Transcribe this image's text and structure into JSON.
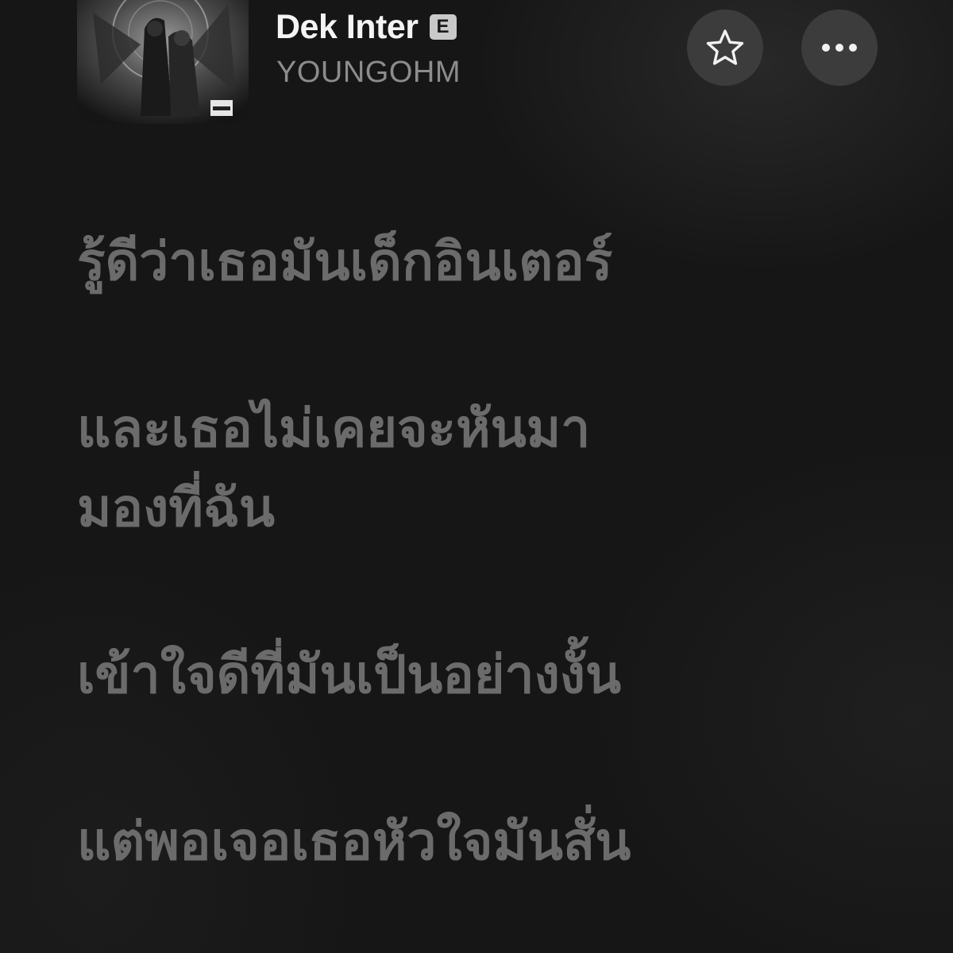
{
  "now_playing": {
    "title": "Dek Inter",
    "explicit_badge": "E",
    "artist": "YOUNGOHM",
    "artwork_icon": "album-artwork",
    "favorite_icon": "star-icon",
    "more_icon": "ellipsis-icon"
  },
  "colors": {
    "background": "#161616",
    "title": "#f4f4f4",
    "artist": "#8c8c8c",
    "lyrics_inactive": "#6b6b6b",
    "button_bg": "#3c3c3c"
  },
  "lyrics": [
    {
      "lines": [
        "รู้ดีว่าเธอมันเด็กอินเตอร์"
      ]
    },
    {
      "lines": [
        "และเธอไม่เคยจะหันมา",
        "มองที่ฉัน"
      ]
    },
    {
      "lines": [
        "เข้าใจดีที่มันเป็นอย่างงั้น"
      ]
    },
    {
      "lines": [
        "แต่พอเจอเธอหัวใจมันสั่น"
      ]
    }
  ]
}
